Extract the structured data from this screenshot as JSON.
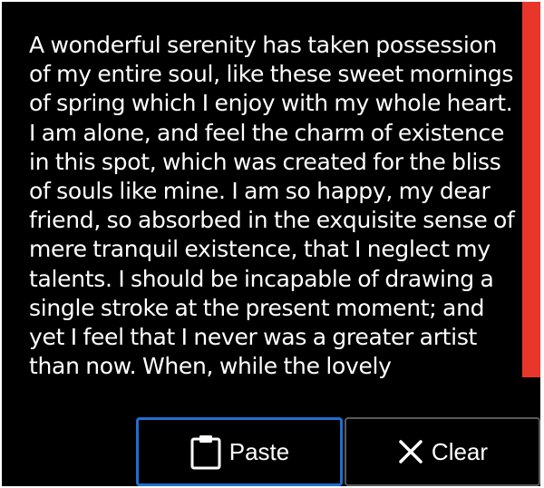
{
  "text_area": {
    "content": "A wonderful serenity has taken possession of my entire soul, like these sweet mornings of spring which I enjoy with my whole heart. I am alone, and feel the charm of existence in this spot, which was created for the bliss of souls like mine. I am so happy, my dear friend, so absorbed in the exquisite sense of mere tranquil existence, that I neglect my talents. I should be incapable of drawing a single stroke at the present moment; and yet I feel that I never was a greater artist than now. When, while the lovely"
  },
  "buttons": {
    "paste": {
      "label": "Paste",
      "icon": "clipboard-icon"
    },
    "clear": {
      "label": "Clear",
      "icon": "close-icon"
    }
  },
  "colors": {
    "background": "#000000",
    "text": "#ffffff",
    "scrollbar": "#e8372a",
    "focus_border": "#1f6fd1"
  }
}
